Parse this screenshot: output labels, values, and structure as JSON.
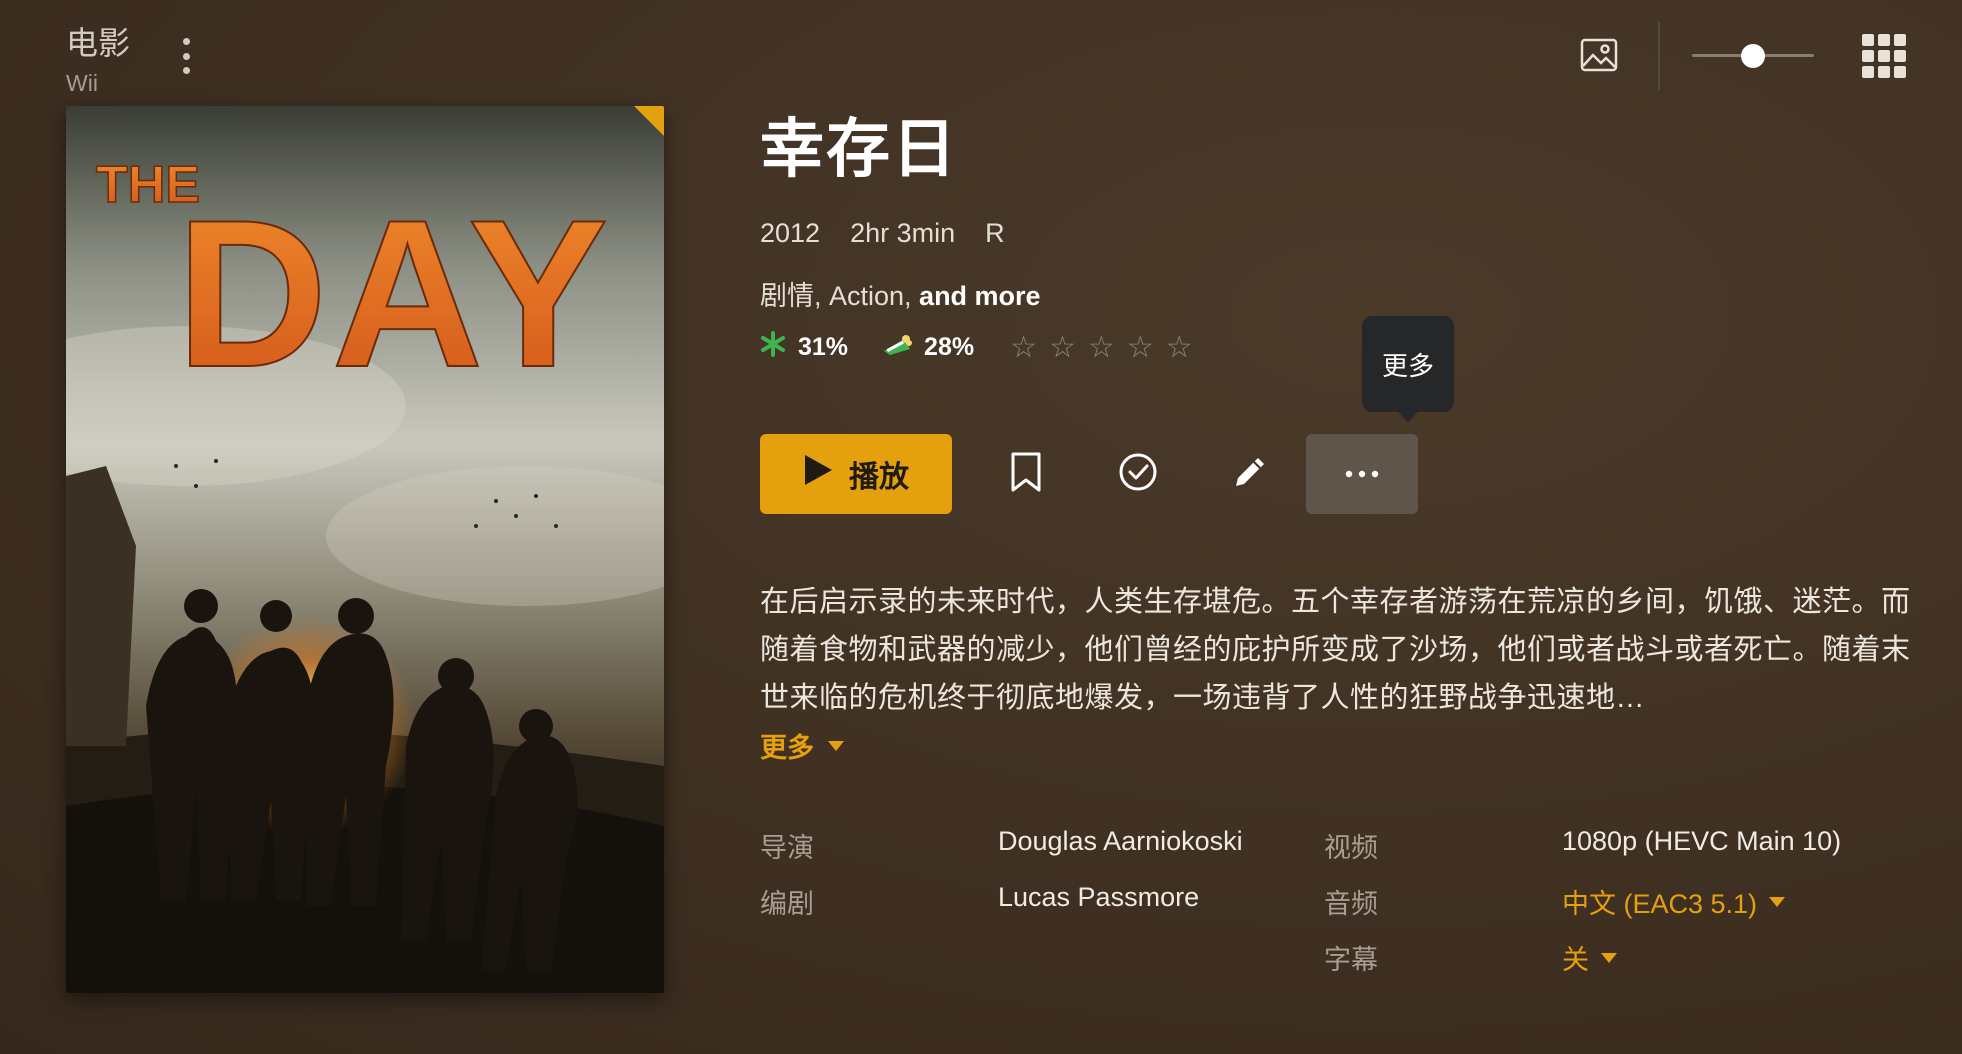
{
  "library": {
    "title": "电影",
    "subtitle": "Wii"
  },
  "toolbar": {
    "poster_size": 0.5
  },
  "movie": {
    "title": "幸存日",
    "year": "2012",
    "duration": "2hr 3min",
    "content_rating": "R",
    "genres_text": "剧情, Action, ",
    "genres_more": "and more",
    "ratings": {
      "critic": "31%",
      "audience": "28%",
      "user_stars": 0,
      "max_stars": 5
    },
    "poster": {
      "title_small": "THE",
      "title_big": "DAY"
    },
    "summary": "在后启示录的未来时代，人类生存堪危。五个幸存者游荡在荒凉的乡间，饥饿、迷茫。而随着食物和武器的减少，他们曾经的庇护所变成了沙场，他们或者战斗或者死亡。随着末世来临的危机终于彻底地爆发，一场违背了人性的狂野战争迅速地…",
    "summary_more": "更多"
  },
  "actions": {
    "play_label": "播放",
    "more_tooltip": "更多"
  },
  "details": {
    "director_label": "导演",
    "director": "Douglas Aarniokoski",
    "writer_label": "编剧",
    "writer": "Lucas Passmore",
    "video_label": "视频",
    "video": "1080p (HEVC Main 10)",
    "audio_label": "音频",
    "audio": "中文 (EAC3 5.1)",
    "subtitle_label": "字幕",
    "subtitle": "关"
  },
  "colors": {
    "accent": "#e5a00d",
    "critic_icon": "#3fb34f",
    "background": "#3f3022"
  }
}
